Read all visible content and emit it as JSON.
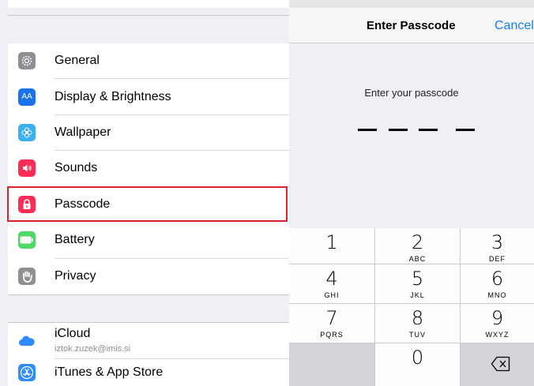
{
  "settings": {
    "items": [
      {
        "label": "General",
        "icon": "gear-icon",
        "color": "#8e8e93"
      },
      {
        "label": "Display & Brightness",
        "icon": "display-brightness-icon",
        "color": "#1a73e8",
        "glyph": "AA"
      },
      {
        "label": "Wallpaper",
        "icon": "wallpaper-icon",
        "color": "#3ab0f0"
      },
      {
        "label": "Sounds",
        "icon": "speaker-icon",
        "color": "#ff2d55"
      },
      {
        "label": "Passcode",
        "icon": "lock-icon",
        "color": "#ff2d55"
      },
      {
        "label": "Battery",
        "icon": "battery-icon",
        "color": "#4cd964"
      },
      {
        "label": "Privacy",
        "icon": "hand-icon",
        "color": "#8e8e93"
      }
    ],
    "account_items": [
      {
        "label": "iCloud",
        "sublabel": "iztok.zuzek@imis.si",
        "icon": "cloud-icon",
        "color": "#2f8bff"
      },
      {
        "label": "iTunes & App Store",
        "icon": "app-store-icon",
        "color": "#2f8bff"
      }
    ],
    "highlight_color": "#e0202c"
  },
  "passcode": {
    "title": "Enter Passcode",
    "cancel_label": "Cancel",
    "prompt": "Enter your passcode",
    "dash_count": 4
  },
  "keypad": {
    "keys": [
      {
        "num": "1",
        "letters": ""
      },
      {
        "num": "2",
        "letters": "ABC"
      },
      {
        "num": "3",
        "letters": "DEF"
      },
      {
        "num": "4",
        "letters": "GHI"
      },
      {
        "num": "5",
        "letters": "JKL"
      },
      {
        "num": "6",
        "letters": "MNO"
      },
      {
        "num": "7",
        "letters": "PQRS"
      },
      {
        "num": "8",
        "letters": "TUV"
      },
      {
        "num": "9",
        "letters": "WXYZ"
      },
      {
        "num": "0",
        "letters": ""
      }
    ],
    "delete_icon": "backspace-icon"
  }
}
